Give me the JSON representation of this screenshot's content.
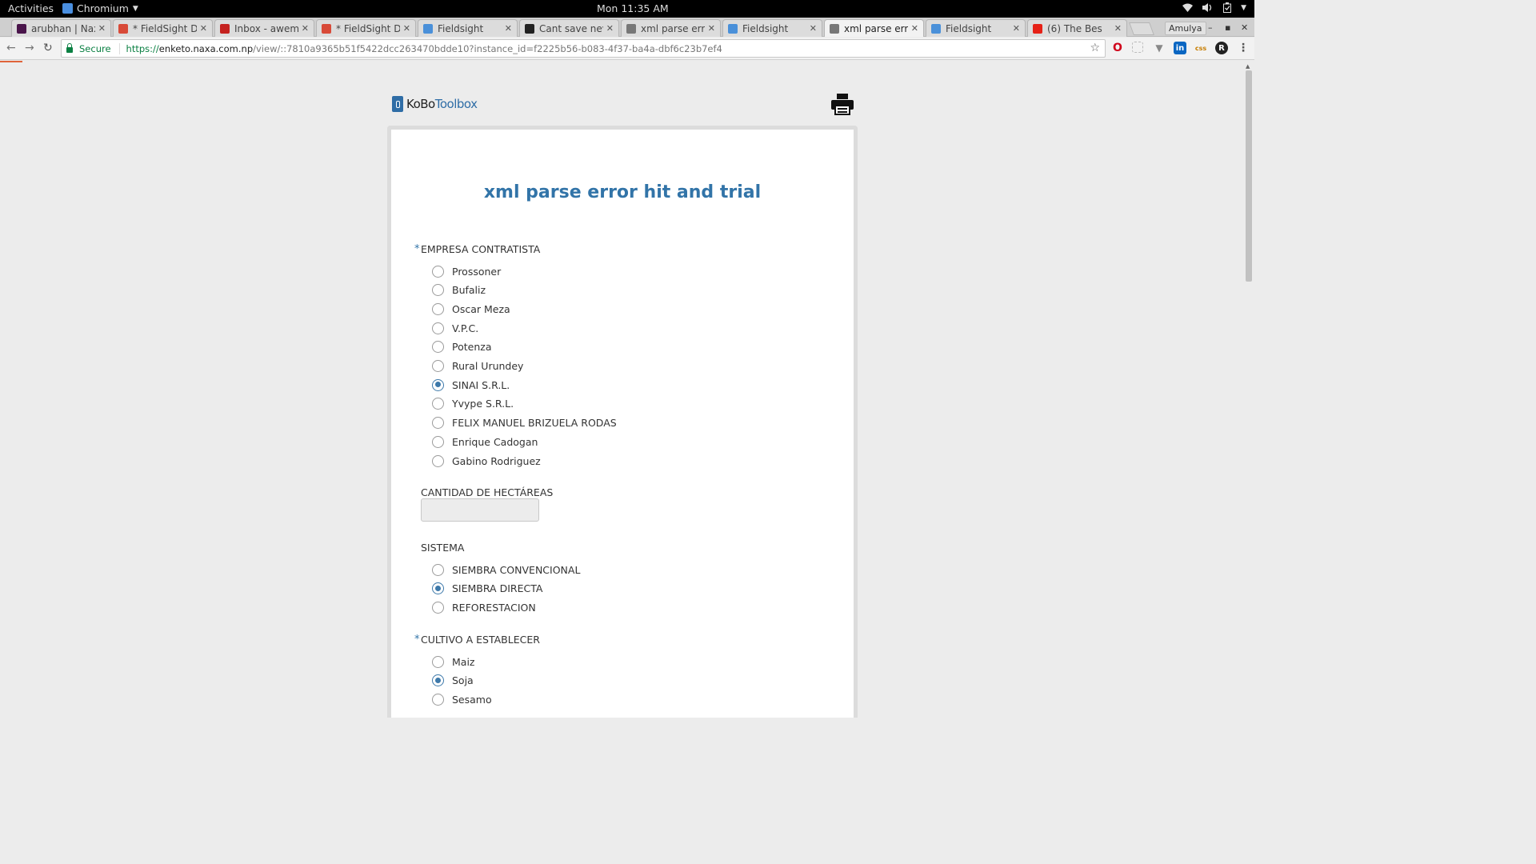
{
  "system": {
    "activities": "Activities",
    "app_name": "Chromium",
    "clock": "Mon 11:35 AM"
  },
  "browser": {
    "tabs": [
      {
        "title": "arubhan | Nax",
        "icon": "slack-icon",
        "color": "#4a154b"
      },
      {
        "title": "* FieldSight D",
        "icon": "fieldsight-doc-icon",
        "color": "#d84a38"
      },
      {
        "title": "Inbox - awem",
        "icon": "gmail-icon",
        "color": "#c5221f"
      },
      {
        "title": "* FieldSight D",
        "icon": "fieldsight-doc-icon",
        "color": "#d84a38"
      },
      {
        "title": "Fieldsight",
        "icon": "fieldsight-icon",
        "color": "#4a90d9"
      },
      {
        "title": "Cant save nev",
        "icon": "github-icon",
        "color": "#222222"
      },
      {
        "title": "xml parse erro",
        "icon": "document-icon",
        "color": "#777777"
      },
      {
        "title": "Fieldsight",
        "icon": "fieldsight-icon",
        "color": "#4a90d9"
      },
      {
        "title": "xml parse erro",
        "icon": "document-icon",
        "color": "#777777",
        "active": true
      },
      {
        "title": "Fieldsight",
        "icon": "fieldsight-icon",
        "color": "#4a90d9"
      },
      {
        "title": "(6) The Bes",
        "icon": "youtube-icon",
        "color": "#e62117"
      }
    ],
    "profile": "Amulya",
    "secure_label": "Secure",
    "url": {
      "scheme": "https://",
      "host": "enketo.naxa.com.np",
      "path": "/view/::7810a9365b51f5422dcc263470bdde10?instance_id=f2225b56-b083-4f37-ba4a-dbf6c23b7ef4"
    }
  },
  "page": {
    "logo": {
      "part1": "KoBo",
      "part2": "Toolbox"
    },
    "form_title": "xml parse error hit and trial",
    "questions": {
      "empresa": {
        "label": "EMPRESA CONTRATISTA",
        "required_mark": "*",
        "options": [
          "Prossoner",
          "Bufaliz",
          "Oscar Meza",
          "V.P.C.",
          "Potenza",
          "Rural Urundey",
          "SINAI S.R.L.",
          "Yvype S.R.L.",
          "FELIX MANUEL BRIZUELA RODAS",
          "Enrique Cadogan",
          "Gabino Rodriguez"
        ],
        "selected": "SINAI S.R.L."
      },
      "cantidad": {
        "label": "CANTIDAD DE HECTÁREAS",
        "value": ""
      },
      "sistema": {
        "label": "SISTEMA",
        "options": [
          "SIEMBRA CONVENCIONAL",
          "SIEMBRA DIRECTA",
          "REFORESTACION"
        ],
        "selected": "SIEMBRA DIRECTA"
      },
      "cultivo": {
        "label": "CULTIVO A ESTABLECER",
        "required_mark": "*",
        "options": [
          "Maiz",
          "Soja",
          "Sesamo"
        ],
        "selected": "Soja"
      }
    }
  },
  "colors": {
    "accent": "#3274a8",
    "secure": "#0b8043"
  }
}
